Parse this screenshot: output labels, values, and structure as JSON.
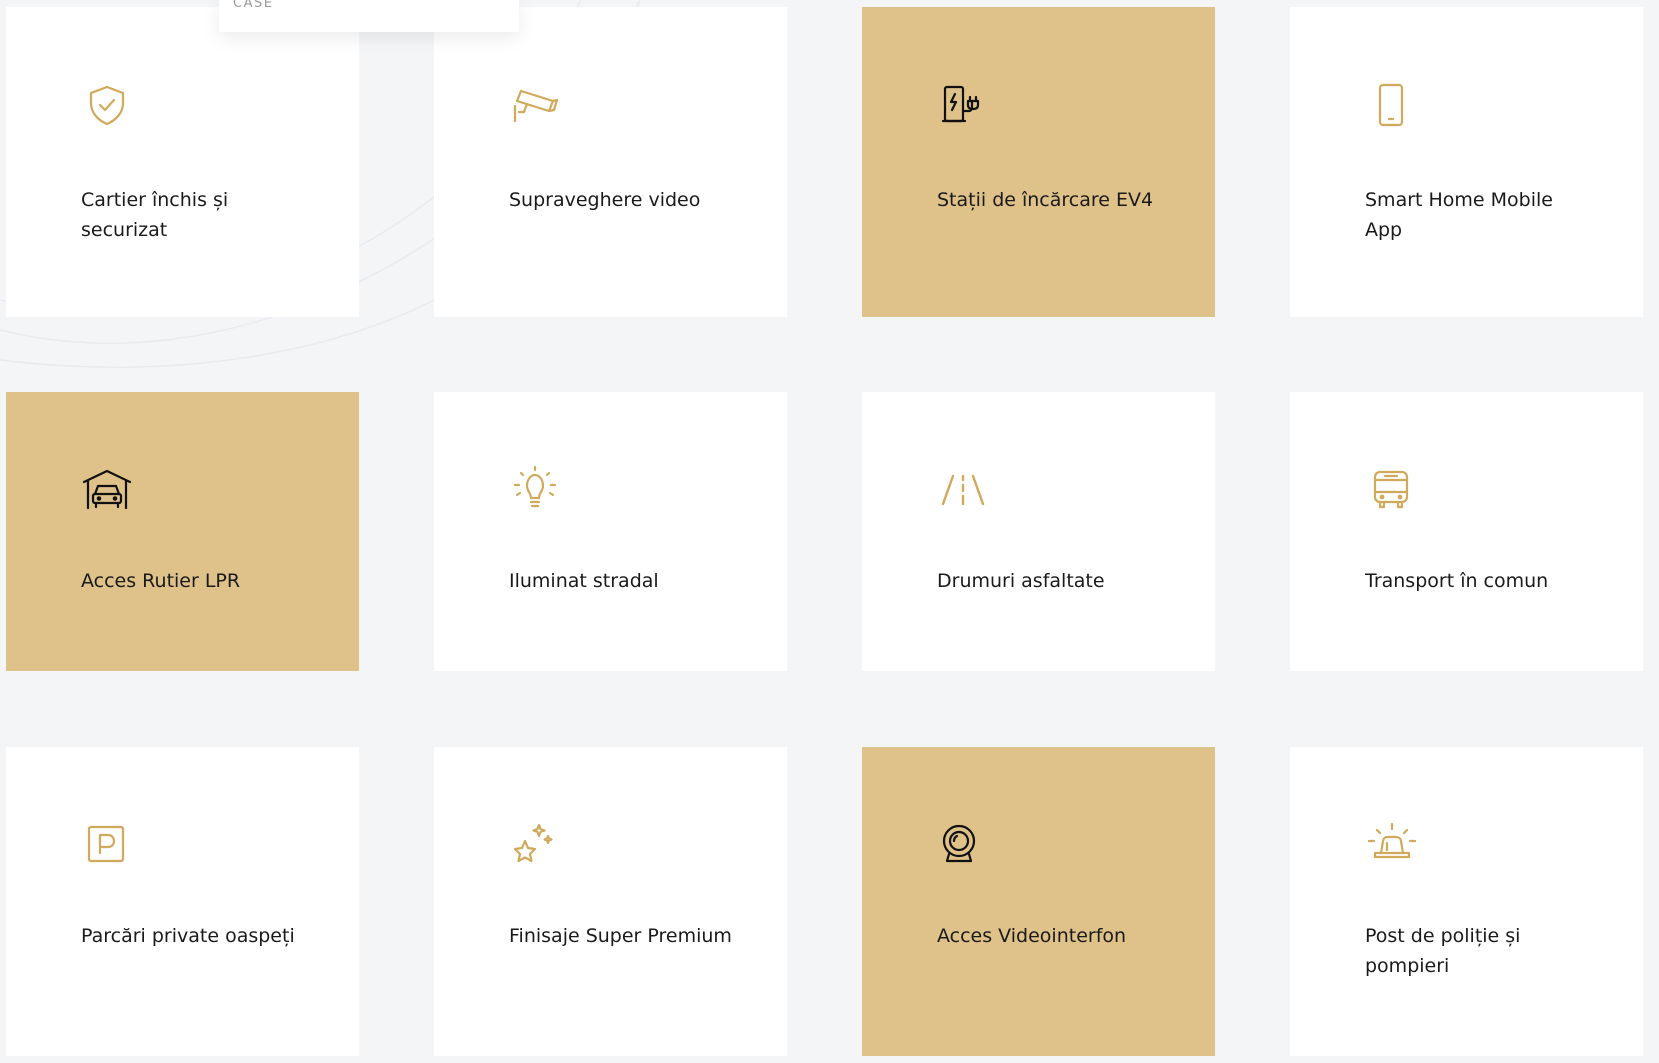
{
  "menu": {
    "tab_label": "CASE"
  },
  "features": [
    {
      "label": "Cartier închis și securizat",
      "icon": "shield-check-icon"
    },
    {
      "label": "Supraveghere video",
      "icon": "cctv-camera-icon"
    },
    {
      "label": "Stații de încărcare EV4",
      "icon": "ev-charger-icon"
    },
    {
      "label": "Smart Home Mobile App",
      "icon": "smartphone-icon"
    },
    {
      "label": "Acces Rutier LPR",
      "icon": "garage-car-icon"
    },
    {
      "label": "Iluminat stradal",
      "icon": "light-bulb-icon"
    },
    {
      "label": "Drumuri asfaltate",
      "icon": "road-icon"
    },
    {
      "label": "Transport în comun",
      "icon": "bus-icon"
    },
    {
      "label": "Parcări private oaspeți",
      "icon": "parking-icon"
    },
    {
      "label": "Finisaje Super Premium",
      "icon": "sparkle-star-icon"
    },
    {
      "label": "Acces Videointerfon",
      "icon": "webcam-icon"
    },
    {
      "label": "Post de poliție și pompieri",
      "icon": "siren-icon"
    }
  ],
  "colors": {
    "page_background": "#f4f5f7",
    "card_background": "#ffffff",
    "card_highlight": "#dfc18a",
    "icon_gold": "#d0a95a",
    "icon_dark": "#111111",
    "text": "#1a1a1a"
  }
}
